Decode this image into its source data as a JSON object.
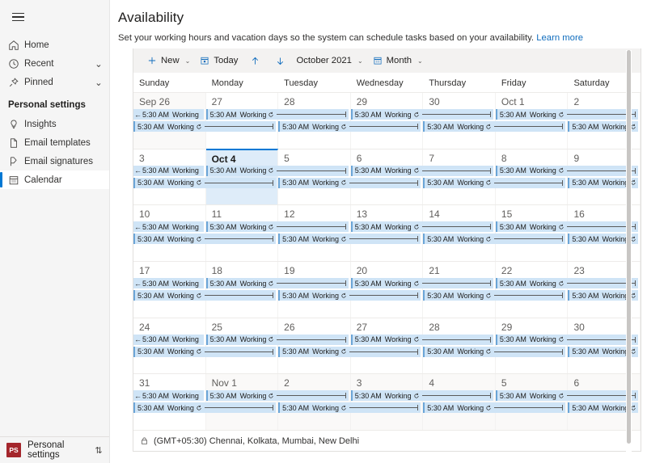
{
  "sidebar": {
    "menu_icon": "hamburger-icon",
    "items": [
      {
        "label": "Home",
        "icon": "home-icon",
        "chevron": ""
      },
      {
        "label": "Recent",
        "icon": "clock-icon",
        "chevron": "⌄"
      },
      {
        "label": "Pinned",
        "icon": "pin-icon",
        "chevron": "⌄"
      }
    ],
    "section_label": "Personal settings",
    "settings_items": [
      {
        "label": "Insights",
        "icon": "lightbulb-icon",
        "selected": false
      },
      {
        "label": "Email templates",
        "icon": "document-icon",
        "selected": false
      },
      {
        "label": "Email signatures",
        "icon": "signature-icon",
        "selected": false
      },
      {
        "label": "Calendar",
        "icon": "calendar-icon",
        "selected": true
      }
    ],
    "footer": {
      "badge": "PS",
      "label": "Personal settings",
      "chevron": "⇅",
      "badge_color": "#a4262c"
    }
  },
  "header": {
    "title": "Availability",
    "description": "Set your working hours and vacation days so the system can schedule tasks based on your availability.",
    "link_text": "Learn more",
    "link_color": "#0f6cbd"
  },
  "toolbar": {
    "new_label": "New",
    "new_icon": "plus-icon",
    "new_chevron": "⌄",
    "today_label": "Today",
    "today_icon": "calendar-day-icon",
    "prev_icon": "arrow-up-icon",
    "next_icon": "arrow-down-icon",
    "period_label": "October 2021",
    "period_chevron": "⌄",
    "view_label": "Month",
    "view_icon": "calendar-month-icon",
    "view_chevron": "⌄"
  },
  "calendar": {
    "day_names": [
      "Sunday",
      "Monday",
      "Tuesday",
      "Wednesday",
      "Thursday",
      "Friday",
      "Saturday"
    ],
    "event_time": "5:30 AM",
    "event_title": "Working",
    "recurrence_icon": "recurrence-icon",
    "weeks": [
      {
        "days": [
          {
            "num": "Sep 26",
            "other": true,
            "today": false
          },
          {
            "num": "27",
            "other": false,
            "today": false
          },
          {
            "num": "28",
            "other": false,
            "today": false
          },
          {
            "num": "29",
            "other": false,
            "today": false
          },
          {
            "num": "30",
            "other": false,
            "today": false
          },
          {
            "num": "Oct 1",
            "other": false,
            "today": false
          },
          {
            "num": "2",
            "other": false,
            "today": false
          }
        ]
      },
      {
        "days": [
          {
            "num": "3",
            "other": false,
            "today": false
          },
          {
            "num": "Oct 4",
            "other": false,
            "today": true
          },
          {
            "num": "5",
            "other": false,
            "today": false
          },
          {
            "num": "6",
            "other": false,
            "today": false
          },
          {
            "num": "7",
            "other": false,
            "today": false
          },
          {
            "num": "8",
            "other": false,
            "today": false
          },
          {
            "num": "9",
            "other": false,
            "today": false
          }
        ]
      },
      {
        "days": [
          {
            "num": "10",
            "other": false,
            "today": false
          },
          {
            "num": "11",
            "other": false,
            "today": false
          },
          {
            "num": "12",
            "other": false,
            "today": false
          },
          {
            "num": "13",
            "other": false,
            "today": false
          },
          {
            "num": "14",
            "other": false,
            "today": false
          },
          {
            "num": "15",
            "other": false,
            "today": false
          },
          {
            "num": "16",
            "other": false,
            "today": false
          }
        ]
      },
      {
        "days": [
          {
            "num": "17",
            "other": false,
            "today": false
          },
          {
            "num": "18",
            "other": false,
            "today": false
          },
          {
            "num": "19",
            "other": false,
            "today": false
          },
          {
            "num": "20",
            "other": false,
            "today": false
          },
          {
            "num": "21",
            "other": false,
            "today": false
          },
          {
            "num": "22",
            "other": false,
            "today": false
          },
          {
            "num": "23",
            "other": false,
            "today": false
          }
        ]
      },
      {
        "days": [
          {
            "num": "24",
            "other": false,
            "today": false
          },
          {
            "num": "25",
            "other": false,
            "today": false
          },
          {
            "num": "26",
            "other": false,
            "today": false
          },
          {
            "num": "27",
            "other": false,
            "today": false
          },
          {
            "num": "28",
            "other": false,
            "today": false
          },
          {
            "num": "29",
            "other": false,
            "today": false
          },
          {
            "num": "30",
            "other": false,
            "today": false
          }
        ]
      },
      {
        "days": [
          {
            "num": "31",
            "other": false,
            "today": false
          },
          {
            "num": "Nov 1",
            "other": true,
            "today": false
          },
          {
            "num": "2",
            "other": true,
            "today": false
          },
          {
            "num": "3",
            "other": true,
            "today": false
          },
          {
            "num": "4",
            "other": true,
            "today": false
          },
          {
            "num": "5",
            "other": true,
            "today": false
          },
          {
            "num": "6",
            "other": true,
            "today": false
          }
        ]
      }
    ],
    "event_rows": [
      {
        "lane": 0,
        "start": 0,
        "span": 1,
        "continues_left": true,
        "continues_right": false
      },
      {
        "lane": 0,
        "start": 1,
        "span": 2,
        "continues_left": false,
        "continues_right": false
      },
      {
        "lane": 0,
        "start": 3,
        "span": 2,
        "continues_left": false,
        "continues_right": false
      },
      {
        "lane": 0,
        "start": 5,
        "span": 2,
        "continues_left": false,
        "continues_right": false
      },
      {
        "lane": 1,
        "start": 0,
        "span": 2,
        "continues_left": false,
        "continues_right": false
      },
      {
        "lane": 1,
        "start": 2,
        "span": 2,
        "continues_left": false,
        "continues_right": false
      },
      {
        "lane": 1,
        "start": 4,
        "span": 2,
        "continues_left": false,
        "continues_right": false
      },
      {
        "lane": 1,
        "start": 6,
        "span": 1,
        "continues_left": false,
        "continues_right": true
      }
    ],
    "footer": {
      "lock_icon": "lock-icon",
      "timezone": "(GMT+05:30) Chennai, Kolkata, Mumbai, New Delhi"
    }
  },
  "colors": {
    "accent": "#0078d4",
    "event_bg": "#cfe4f6",
    "event_border": "#6ba5d7",
    "today_bg": "#deecf9",
    "toolbar_bg": "#f3f2f1",
    "sidebar_bg": "#f5f5f5"
  }
}
